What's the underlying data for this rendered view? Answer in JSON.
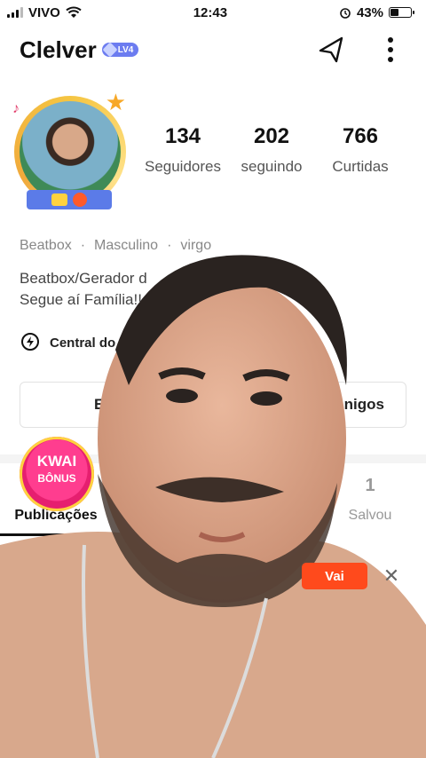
{
  "status_bar": {
    "carrier": "VIVO",
    "time": "12:43",
    "battery": "43%",
    "battery_level": 0.43
  },
  "header": {
    "username": "Clelver",
    "level": "LV4"
  },
  "stats": [
    {
      "value": "134",
      "label": "Seguidores"
    },
    {
      "value": "202",
      "label": "seguindo"
    },
    {
      "value": "766",
      "label": "Curtidas"
    }
  ],
  "tags": [
    "Beatbox",
    "Masculino",
    "virgo"
  ],
  "bio": {
    "line1": "Beatbox/Gerador d",
    "line2": "Segue aí Família!!"
  },
  "central": {
    "label": "Central do C"
  },
  "buttons": {
    "edit": "Edit",
    "friends": "nigos"
  },
  "bonus": {
    "line1": "KWAI",
    "line2": "BÔNUS"
  },
  "tabs": [
    {
      "count": "",
      "label": "Publicações"
    },
    {
      "count": "1",
      "label": "Salvou"
    }
  ],
  "promo": {
    "action": "Vai",
    "close": "✕"
  }
}
